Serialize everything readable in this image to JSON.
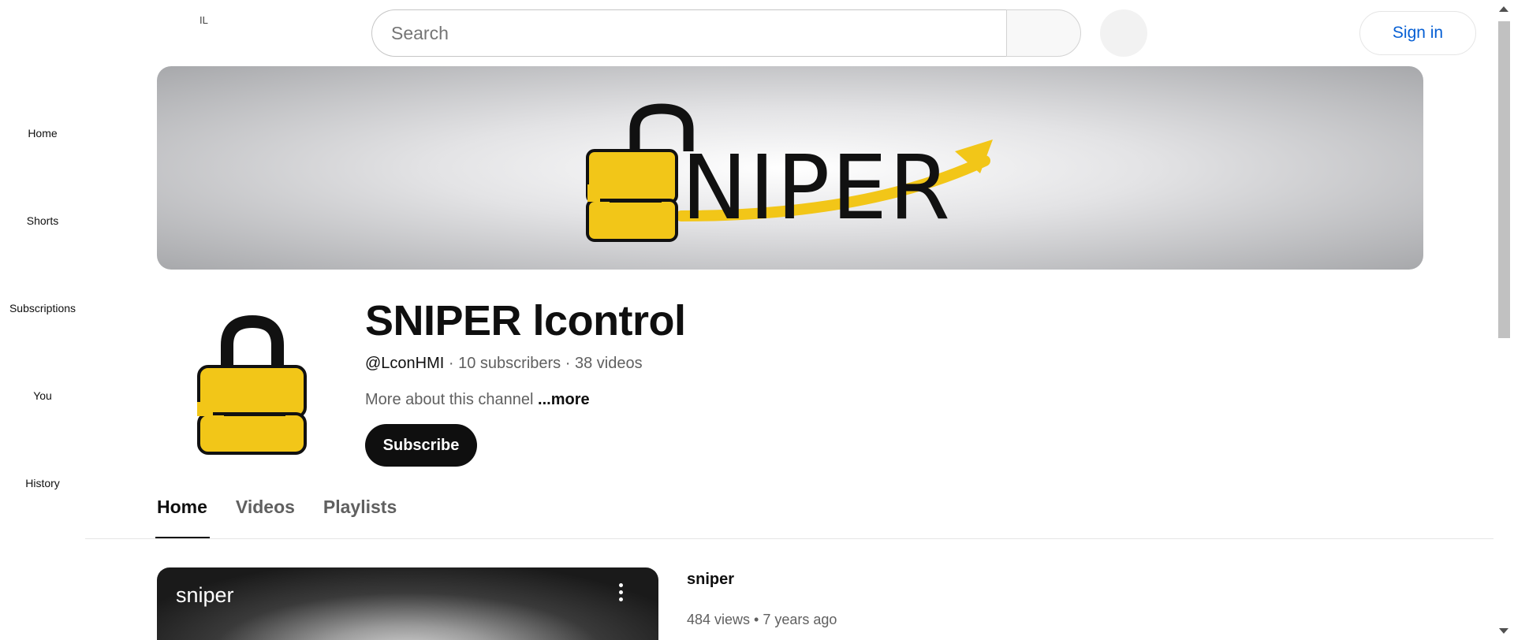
{
  "header": {
    "country_code": "IL",
    "search": {
      "placeholder": "Search",
      "value": ""
    },
    "search_button_icon": "search-icon",
    "voice_button_icon": "microphone-icon",
    "signin_label": "Sign in"
  },
  "sidebar": {
    "items": [
      {
        "label": "Home",
        "icon": "home-icon"
      },
      {
        "label": "Shorts",
        "icon": "shorts-icon"
      },
      {
        "label": "Subscriptions",
        "icon": "subscriptions-icon"
      },
      {
        "label": "You",
        "icon": "you-icon"
      },
      {
        "label": "History",
        "icon": "history-icon"
      }
    ]
  },
  "banner": {
    "logo_text": "NIPER",
    "accent_color": "#f2c618"
  },
  "channel": {
    "name": "SNIPER lcontrol",
    "handle": "@LconHMI",
    "separator": " · ",
    "subscribers": "10 subscribers",
    "videos": "38 videos",
    "description": "More about this channel",
    "more_label": "...more",
    "subscribe_label": "Subscribe"
  },
  "tabs": [
    {
      "label": "Home",
      "active": true
    },
    {
      "label": "Videos",
      "active": false
    },
    {
      "label": "Playlists",
      "active": false
    }
  ],
  "featured_video": {
    "thumb_title": "sniper",
    "title": "sniper",
    "views": "484 views",
    "bullet": " • ",
    "age": "7 years ago",
    "menu_icon": "more-vert-icon"
  },
  "colors": {
    "link_blue": "#065fd4",
    "text_primary": "#0f0f0f",
    "text_secondary": "#606060",
    "brand_yellow": "#f2c618"
  }
}
